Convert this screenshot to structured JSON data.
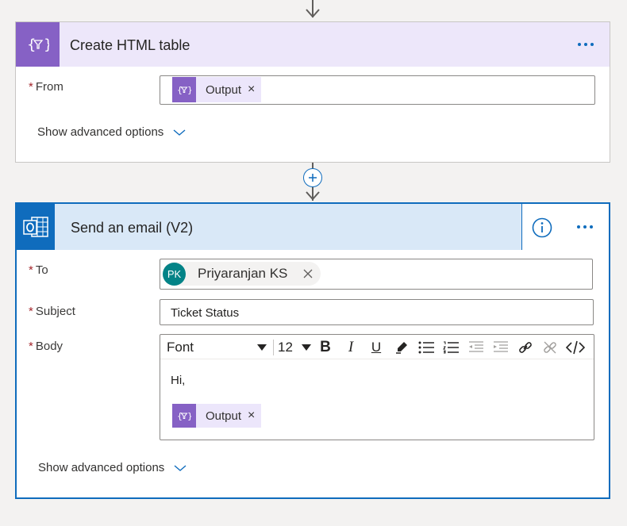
{
  "colors": {
    "accent": "#0f6cbd",
    "data_operation": "#8661c5",
    "data_operation_light": "#ede7fa",
    "outlook": "#0f6cbd",
    "outlook_light": "#d9e8f7",
    "required": "#a4262c",
    "avatar": "#038387"
  },
  "create_table": {
    "title": "Create HTML table",
    "icon": "data-operation-icon",
    "from": {
      "label": "From",
      "required_mark": "*",
      "token": {
        "label": "Output",
        "remove": "×",
        "icon": "data-operation-icon"
      }
    },
    "advanced": {
      "label": "Show advanced options"
    }
  },
  "send_email": {
    "title": "Send an email (V2)",
    "icon": "outlook-icon",
    "to": {
      "label": "To",
      "required_mark": "*",
      "person": {
        "initials": "PK",
        "name": "Priyaranjan KS"
      }
    },
    "subject": {
      "label": "Subject",
      "required_mark": "*",
      "value": "Ticket Status"
    },
    "body": {
      "label": "Body",
      "required_mark": "*",
      "toolbar": {
        "font": "Font",
        "size": "12",
        "bold": "B",
        "italic": "I",
        "underline": "U"
      },
      "text": "Hi,",
      "token": {
        "label": "Output",
        "remove": "×",
        "icon": "data-operation-icon"
      }
    },
    "advanced": {
      "label": "Show advanced options"
    }
  }
}
